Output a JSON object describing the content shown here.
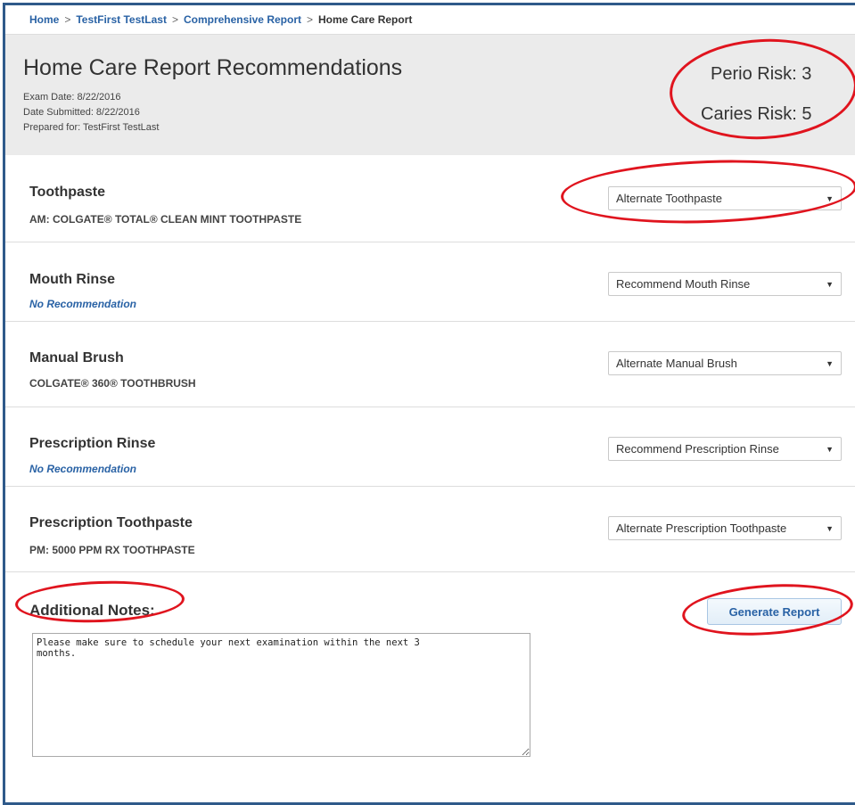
{
  "breadcrumb": {
    "home": "Home",
    "patient": "TestFirst TestLast",
    "comprehensive": "Comprehensive Report",
    "current": "Home Care Report",
    "separator": ">"
  },
  "header": {
    "title": "Home Care Report Recommendations",
    "exam_date": "Exam Date: 8/22/2016",
    "date_submitted": "Date Submitted: 8/22/2016",
    "prepared_for": "Prepared for: TestFirst TestLast",
    "perio_risk": "Perio Risk: 3",
    "caries_risk": "Caries Risk: 5"
  },
  "sections": [
    {
      "title": "Toothpaste",
      "product": "AM: COLGATE® TOTAL® CLEAN MINT TOOTHPASTE",
      "select": "Alternate Toothpaste"
    },
    {
      "title": "Mouth Rinse",
      "product": "No Recommendation",
      "select": "Recommend Mouth Rinse"
    },
    {
      "title": "Manual Brush",
      "product": "COLGATE® 360® TOOTHBRUSH",
      "select": "Alternate Manual Brush"
    },
    {
      "title": "Prescription Rinse",
      "product": "No Recommendation",
      "select": "Recommend Prescription Rinse"
    },
    {
      "title": "Prescription Toothpaste",
      "product": "PM: 5000 PPM RX TOOTHPASTE",
      "select": "Alternate Prescription Toothpaste"
    }
  ],
  "notes": {
    "title": "Additional Notes:",
    "value": "Please make sure to schedule your next examination within the next 3\nmonths."
  },
  "generate_button": "Generate Report",
  "colors": {
    "link": "#2962a5",
    "highlight": "#e0141e",
    "header_bg": "#ebebeb",
    "frame": "#2f5a8a"
  }
}
